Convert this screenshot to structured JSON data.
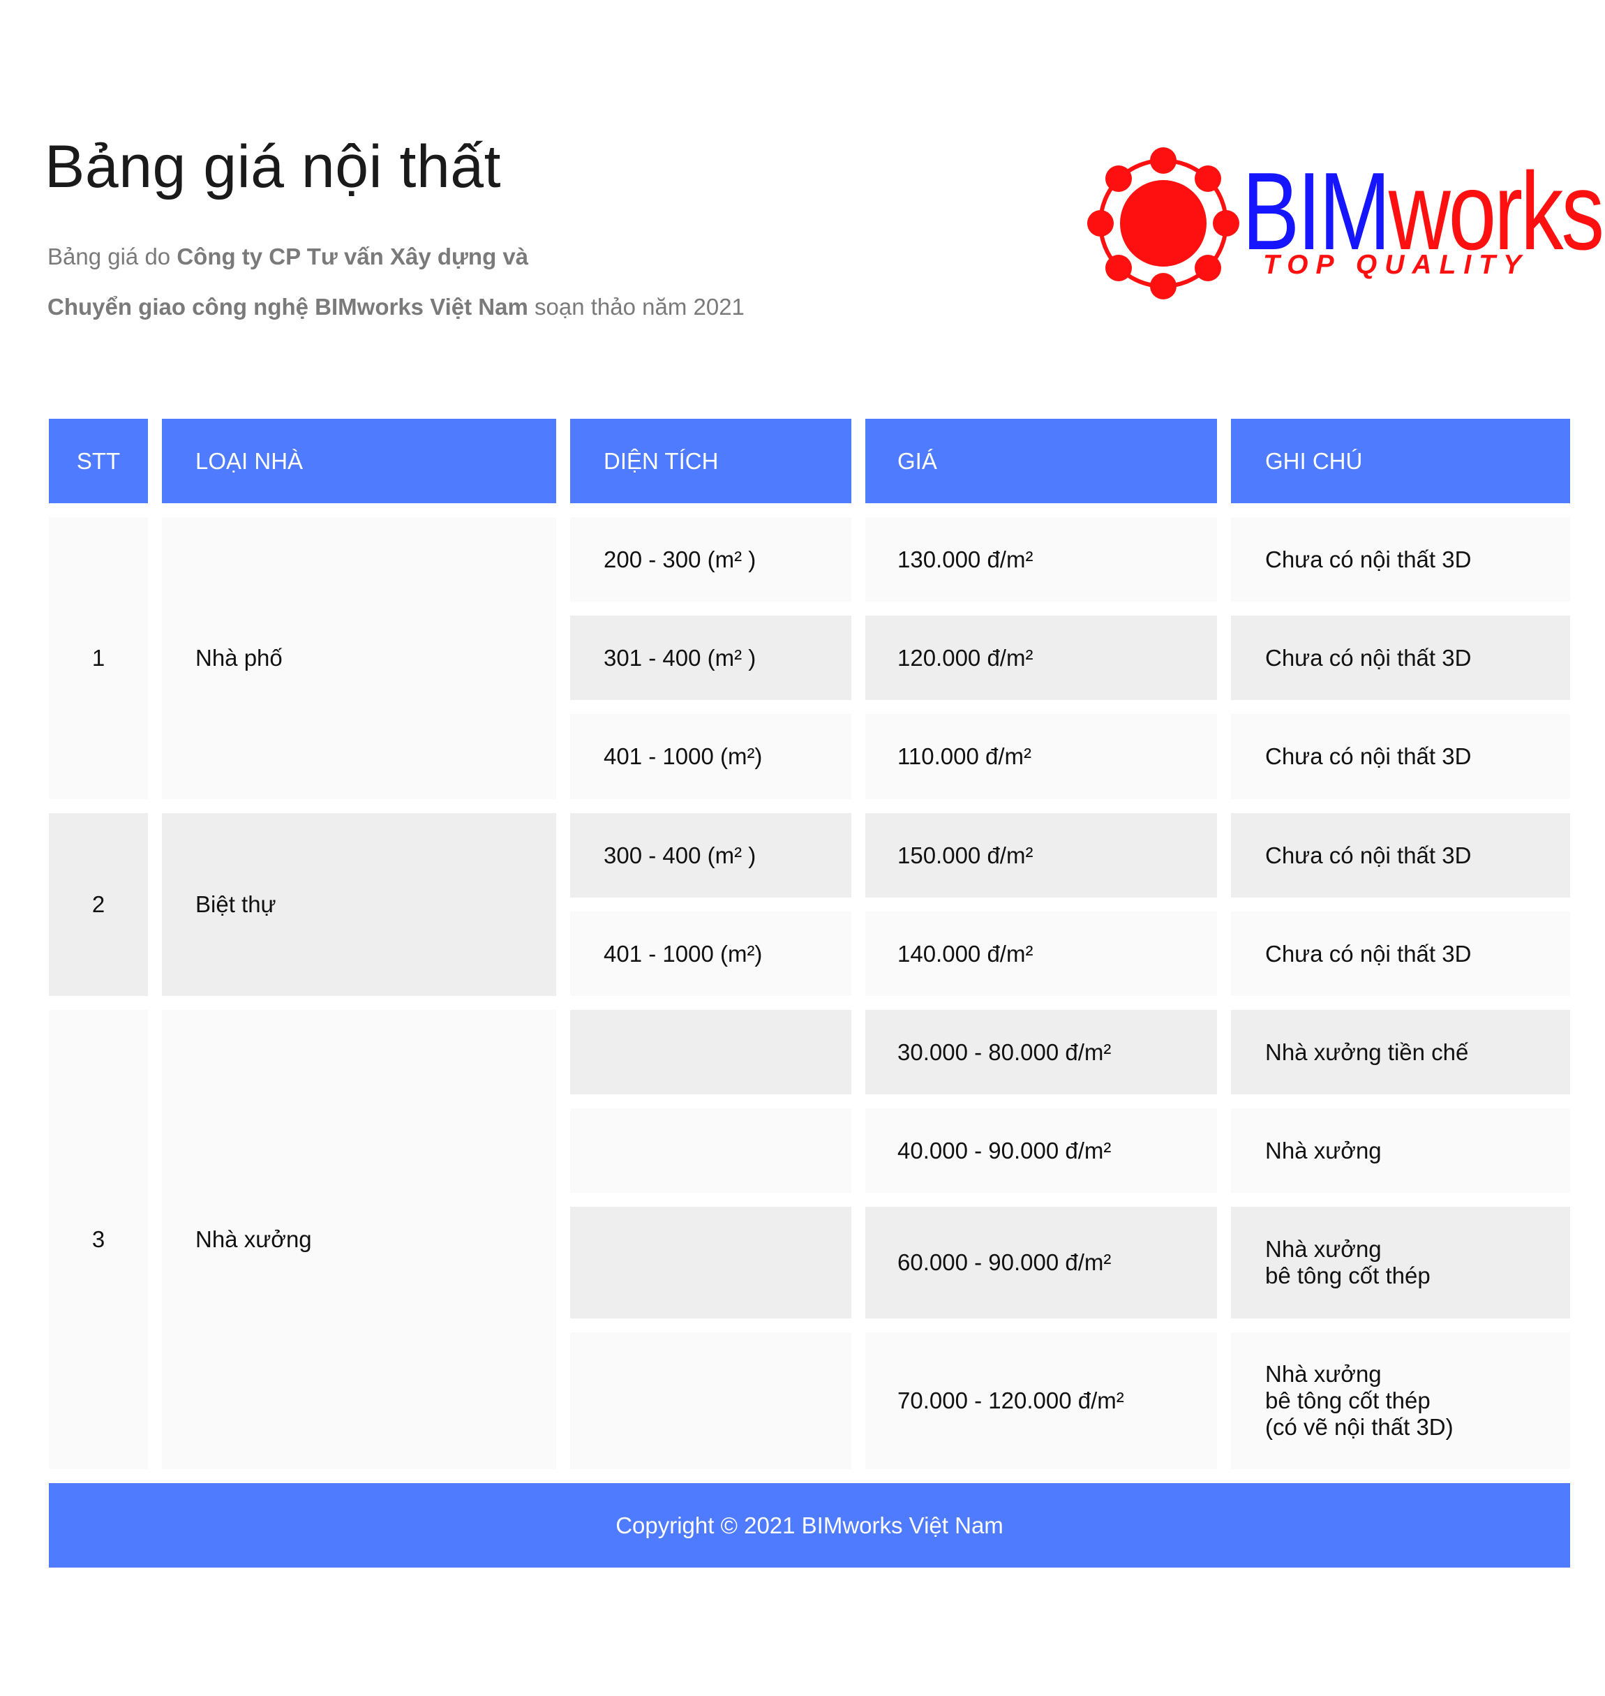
{
  "header": {
    "title": "Bảng giá nội thất",
    "subtitle_line1_prefix": "Bảng giá do ",
    "subtitle_line1_bold": "Công ty CP Tư vấn Xây dựng và",
    "subtitle_line2_bold": "Chuyển giao công nghệ BIMworks Việt Nam",
    "subtitle_line2_suffix": " soạn thảo năm 2021"
  },
  "logo": {
    "brand_part1": "BIM",
    "brand_part2": "works",
    "tagline": "TOP QUALITY",
    "colors": {
      "red": "#ff1010",
      "blue": "#1515ff"
    }
  },
  "table": {
    "columns": [
      "STT",
      "LOẠI NHÀ",
      "DIỆN TÍCH",
      "GIÁ",
      "GHI CHÚ"
    ],
    "groups": [
      {
        "stt": "1",
        "type": "Nhà phố"
      },
      {
        "stt": "2",
        "type": "Biệt thự"
      },
      {
        "stt": "3",
        "type": "Nhà xưởng"
      }
    ],
    "rows": [
      {
        "area": "200 - 300 (m² )",
        "price": "130.000 đ/m²",
        "note": "Chưa có nội thất 3D"
      },
      {
        "area": "301 - 400 (m² )",
        "price": "120.000 đ/m²",
        "note": "Chưa có nội thất 3D"
      },
      {
        "area": "401 - 1000 (m²)",
        "price": "110.000 đ/m²",
        "note": "Chưa có nội thất 3D"
      },
      {
        "area": "300 - 400 (m² )",
        "price": "150.000 đ/m²",
        "note": "Chưa có nội thất 3D"
      },
      {
        "area": "401 - 1000 (m²)",
        "price": "140.000 đ/m²",
        "note": "Chưa có nội thất 3D"
      },
      {
        "area": "",
        "price": "30.000 - 80.000 đ/m²",
        "note": "Nhà xưởng tiền chế"
      },
      {
        "area": "",
        "price": "40.000 - 90.000 đ/m²",
        "note": "Nhà xưởng"
      },
      {
        "area": "",
        "price": "60.000 - 90.000 đ/m²",
        "note": "Nhà xưởng\nbê tông cốt thép"
      },
      {
        "area": "",
        "price": "70.000 - 120.000 đ/m²",
        "note": "Nhà xưởng\nbê tông cốt thép\n(có vẽ nội thất 3D)"
      }
    ],
    "colors": {
      "header": "#4e7bff",
      "row_light": "#fafafa",
      "row_dark": "#eeeeee"
    }
  },
  "footer": {
    "copyright": "Copyright © 2021 BIMworks Việt Nam"
  }
}
